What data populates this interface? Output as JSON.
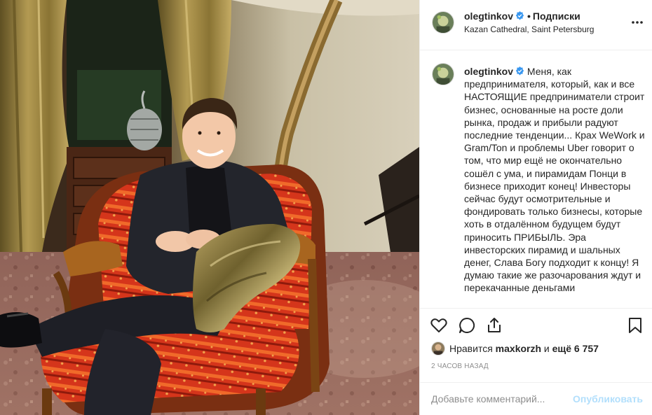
{
  "header": {
    "username": "olegtinkov",
    "separator": "•",
    "follow_label": "Подписки",
    "location": "Kazan Cathedral, Saint Petersburg"
  },
  "caption": {
    "username": "olegtinkov",
    "text": "Меня, как предпринимателя, который, как и все НАСТОЯЩИЕ предприниматели строит бизнес, основанные на росте доли рынка, продаж и прибыли радуют последние тенденции... Крах WeWork и Gram/Ton и проблемы Uber говорит о том, что мир ещё не окончательно сошёл с ума, и пирамидам Понци в бизнесе приходит конец! Инвесторы сейчас будут осмотрительные и фондировать только бизнесы, которые хоть в отдалённом будущем будут приносить ПРИБЫЛЬ. Эра инвесторских пирамид и шальных денег, Слава Богу подходит к концу! Я думаю такие же разочарования ждут и перекачанные деньгами"
  },
  "likes": {
    "prefix": "Нравится",
    "user": "maxkorzh",
    "and": "и",
    "count": "ещё 6 757"
  },
  "timestamp": "2 часов назад",
  "comment": {
    "placeholder": "Добавьте комментарий...",
    "publish_label": "Опубликовать"
  },
  "icons": {
    "like": "heart-icon",
    "comment": "comment-icon",
    "share": "share-icon",
    "save": "bookmark-icon",
    "more": "more-options-icon",
    "verified": "verified-badge-icon"
  },
  "colors": {
    "verified": "#3897f0",
    "publish_disabled": "#b2dffc",
    "muted": "#8e8e8e",
    "border": "#efefef"
  }
}
